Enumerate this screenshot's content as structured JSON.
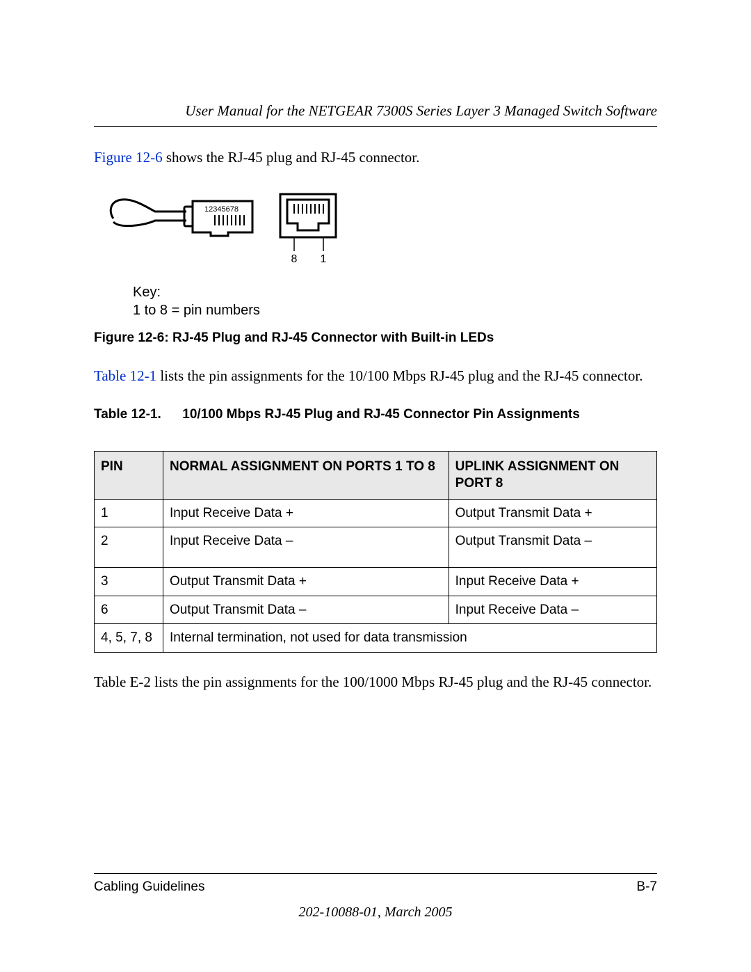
{
  "header": {
    "title": "User Manual for the NETGEAR 7300S Series Layer 3 Managed Switch Software"
  },
  "intro": {
    "link_text": "Figure 12-6",
    "rest_text": " shows the RJ-45 plug and RJ-45 connector."
  },
  "diagram": {
    "pin_label": "12345678",
    "connector_labels": {
      "left": "8",
      "right": "1"
    },
    "key_title": "Key:",
    "key_line": "1 to 8 = pin numbers"
  },
  "fig_caption": "Figure 12-6:  RJ-45 Plug and RJ-45 Connector with Built-in LEDs",
  "table_intro": {
    "link_text": "Table 12-1",
    "rest_text": " lists the pin assignments for the 10/100 Mbps RJ-45 plug and the RJ-45 connector."
  },
  "table_caption": {
    "id": "Table 12-1.",
    "text": "10/100 Mbps RJ-45 Plug and RJ-45 Connector Pin Assignments"
  },
  "table": {
    "headers": {
      "pin": "PIN",
      "normal": "NORMAL ASSIGNMENT ON PORTS 1 TO 8",
      "uplink": "UPLINK ASSIGNMENT ON PORT 8"
    },
    "rows": [
      {
        "pin": "1",
        "normal": "Input Receive Data +",
        "uplink": "Output Transmit Data +"
      },
      {
        "pin": "2",
        "normal": "Input Receive Data –",
        "uplink": "Output Transmit Data –"
      },
      {
        "pin": "3",
        "normal": "Output Transmit Data +",
        "uplink": "Input Receive Data +"
      },
      {
        "pin": "6",
        "normal": "Output Transmit Data –",
        "uplink": "Input Receive Data –"
      }
    ],
    "footer_row": {
      "pin": "4, 5, 7, 8",
      "text": "Internal termination, not used for data transmission"
    }
  },
  "after_table_para": "Table E-2 lists the pin assignments for the 100/1000 Mbps RJ-45 plug and the RJ-45 connector.",
  "footer": {
    "section": "Cabling Guidelines",
    "page": "B-7",
    "docnum": "202-10088-01, March 2005"
  }
}
